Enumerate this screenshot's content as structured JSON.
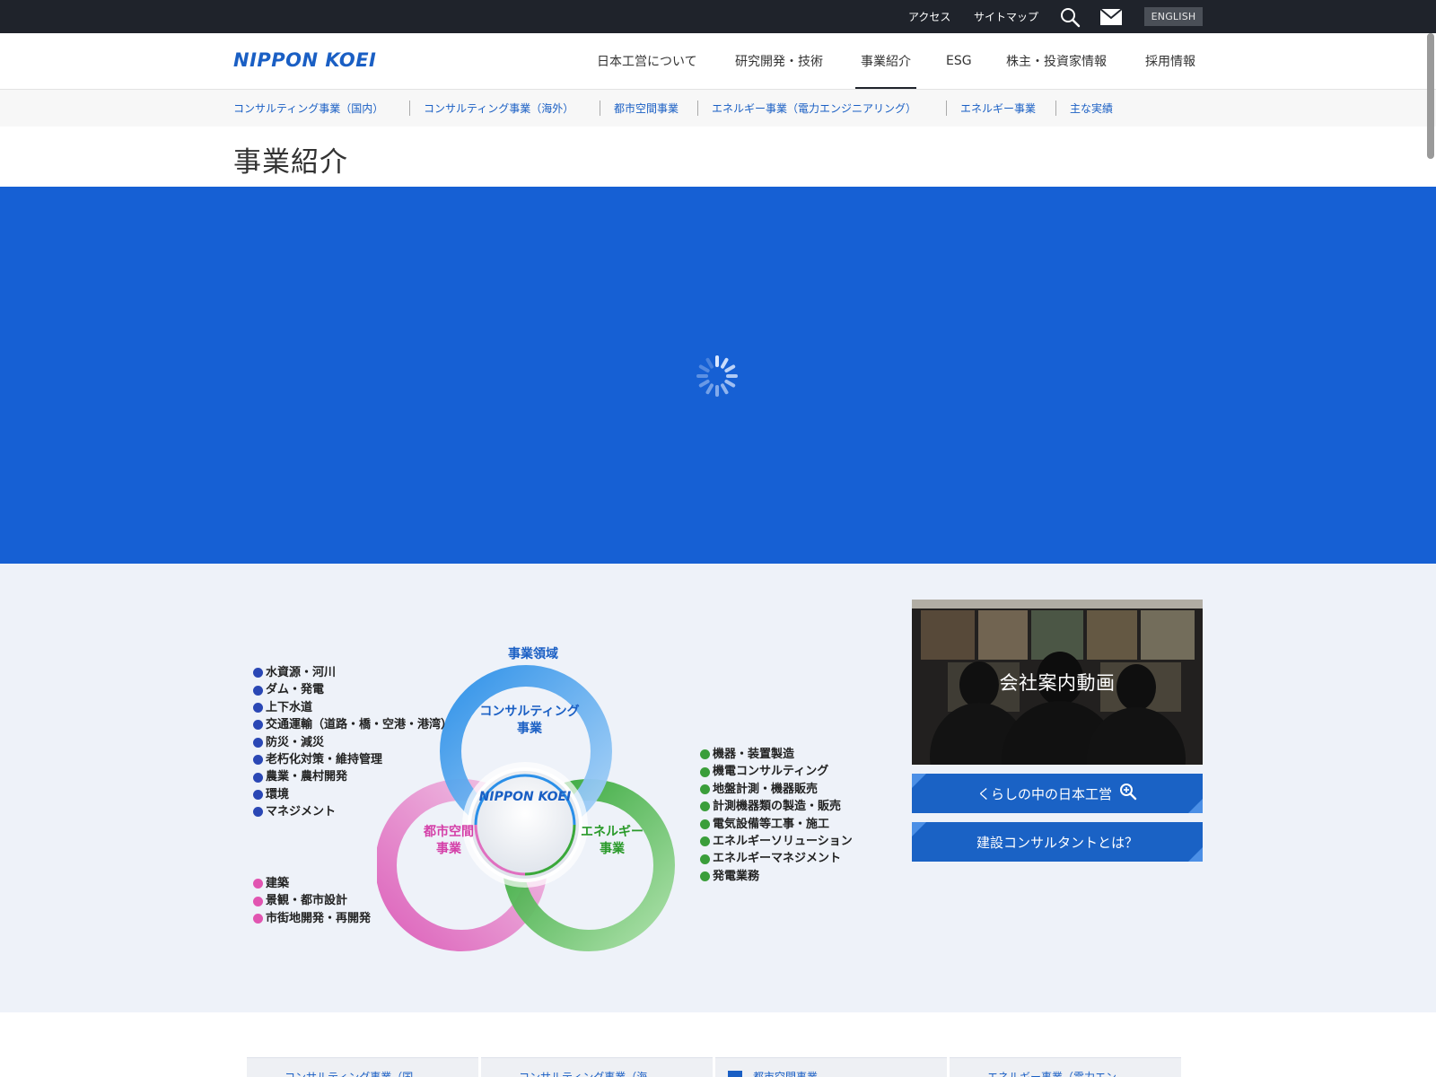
{
  "topbar": {
    "access": "アクセス",
    "sitemap": "サイトマップ",
    "search_icon": "search-icon",
    "mail_icon": "mail-icon",
    "english": "ENGLISH"
  },
  "header": {
    "logo": "NIPPON KOEI",
    "nav": [
      {
        "label": "日本工営について"
      },
      {
        "label": "研究開発・技術"
      },
      {
        "label": "事業紹介",
        "active": true
      },
      {
        "label": "ESG"
      },
      {
        "label": "株主・投資家情報"
      },
      {
        "label": "採用情報"
      }
    ]
  },
  "subnav": [
    "コンサルティング事業（国内）",
    "コンサルティング事業（海外）",
    "都市空間事業",
    "エネルギー事業（電力エンジニアリング）",
    "エネルギー事業",
    "主な実績"
  ],
  "page_title": "事業紹介",
  "hero": {
    "state": "loading",
    "bg_color": "#1660d4"
  },
  "diagram": {
    "title": "事業領域",
    "center_logo": "NIPPON KOEI",
    "consulting": {
      "label_line1": "コンサルティング",
      "label_line2": "事業"
    },
    "urban": {
      "label_line1": "都市空間",
      "label_line2": "事業"
    },
    "energy": {
      "label_line1": "エネルギー",
      "label_line2": "事業"
    },
    "consulting_items": [
      "水資源・河川",
      "ダム・発電",
      "上下水道",
      "交通運輸（道路・橋・空港・港湾）",
      "防災・減災",
      "老朽化対策・維持管理",
      "農業・農村開発",
      "環境",
      "マネジメント"
    ],
    "urban_items": [
      "建築",
      "景観・都市設計",
      "市街地開発・再開発"
    ],
    "energy_items": [
      "機器・装置製造",
      "機電コンサルティング",
      "地盤計測・機器販売",
      "計測機器類の製造・販売",
      "電気設備等工事・施工",
      "エネルギーソリューション",
      "エネルギーマネジメント",
      "発電業務"
    ],
    "colors": {
      "consulting": "#3a9be8",
      "urban": "#e06fc0",
      "energy": "#3aa83a",
      "accent": "#1a5fc4"
    }
  },
  "side": {
    "video_title": "会社案内動画",
    "button1": "くらしの中の日本工営",
    "button2": "建設コンサルタントとは？"
  },
  "cards": [
    "コンサルティング事業（国",
    "コンサルティング事業（海",
    "都市空間事業",
    "エネルギー事業（電力エン"
  ]
}
